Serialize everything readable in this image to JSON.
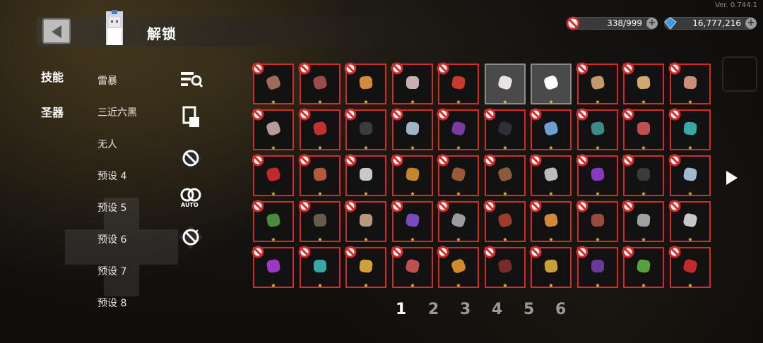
{
  "version": "Ver. 0.744.1",
  "header": {
    "title": "解锁"
  },
  "resources": [
    {
      "name": "coins",
      "value": "338/999"
    },
    {
      "name": "gems",
      "value": "16,777,216"
    }
  ],
  "tabs": [
    "技能",
    "圣器"
  ],
  "presets": [
    "雷暴",
    "三近六黑",
    "无人",
    "预设 4",
    "预设 5",
    "预设 6",
    "预设 7",
    "预设 8"
  ],
  "tools": [
    {
      "name": "equip-search-icon"
    },
    {
      "name": "scroll-hand-icon"
    },
    {
      "name": "ban-icon"
    },
    {
      "name": "auto-icon",
      "label": "AUTO"
    },
    {
      "name": "recycle-ban-icon"
    }
  ],
  "grid": {
    "rows": [
      [
        {
          "icon": "meat-plate-icon",
          "color": "#a06a5a",
          "locked": true
        },
        {
          "icon": "tomato-icon",
          "color": "#9c4a4a",
          "locked": true
        },
        {
          "icon": "amber-gem-icon",
          "color": "#d58a3a",
          "locked": true
        },
        {
          "icon": "feather-icon",
          "color": "#c9b0b0",
          "locked": true
        },
        {
          "icon": "potion-icon",
          "color": "#c63b2a",
          "locked": true
        },
        {
          "icon": "fox-mask-icon",
          "color": "#e9e3e3",
          "locked": false
        },
        {
          "icon": "ghost-icon",
          "color": "#ffffff",
          "locked": false
        },
        {
          "icon": "note-icon",
          "color": "#c49a6c",
          "locked": true
        },
        {
          "icon": "map-icon",
          "color": "#d2a870",
          "locked": true
        },
        {
          "icon": "shell-icon",
          "color": "#c98d7a",
          "locked": true
        }
      ],
      [
        {
          "icon": "needle-icon",
          "color": "#b89a9a",
          "locked": true
        },
        {
          "icon": "demon-mask-icon",
          "color": "#c23030",
          "locked": true
        },
        {
          "icon": "coal-icon",
          "color": "#3c3c3c",
          "locked": true
        },
        {
          "icon": "crystal-shard-icon",
          "color": "#9fb3c9",
          "locked": true
        },
        {
          "icon": "purple-gem-icon",
          "color": "#7a3aa0",
          "locked": true
        },
        {
          "icon": "rock-icon",
          "color": "#2f2f35",
          "locked": true
        },
        {
          "icon": "blue-rock-icon",
          "color": "#6c9fd2",
          "locked": true
        },
        {
          "icon": "tree-icon",
          "color": "#3a8a8a",
          "locked": true
        },
        {
          "icon": "mushroom-icon",
          "color": "#c05050",
          "locked": true
        },
        {
          "icon": "teal-orbs-icon",
          "color": "#3aa7a7",
          "locked": true
        }
      ],
      [
        {
          "icon": "red-scarf-icon",
          "color": "#c02a2a",
          "locked": true
        },
        {
          "icon": "vase-icon",
          "color": "#b45a3a",
          "locked": true
        },
        {
          "icon": "magnifier-icon",
          "color": "#c8c8c8",
          "locked": true
        },
        {
          "icon": "boomerang-icon",
          "color": "#c8842a",
          "locked": true
        },
        {
          "icon": "log-icon",
          "color": "#9a5a3a",
          "locked": true
        },
        {
          "icon": "chocolate-icon",
          "color": "#8a5a3a",
          "locked": true
        },
        {
          "icon": "crystal-ball-icon",
          "color": "#bcbcbc",
          "locked": true
        },
        {
          "icon": "purple-lantern-icon",
          "color": "#8a3ac0",
          "locked": true
        },
        {
          "icon": "book-icon",
          "color": "#3a3a3a",
          "locked": true
        },
        {
          "icon": "ice-cube-icon",
          "color": "#a0b8d0",
          "locked": true
        }
      ],
      [
        {
          "icon": "green-orb-icon",
          "color": "#4a8a3a",
          "locked": true
        },
        {
          "icon": "rifle-icon",
          "color": "#6a5a4a",
          "locked": true
        },
        {
          "icon": "pelt-icon",
          "color": "#b89a7a",
          "locked": true
        },
        {
          "icon": "staff-icon",
          "color": "#7a4ac0",
          "locked": true
        },
        {
          "icon": "crossed-swords-icon",
          "color": "#9a9aa0",
          "locked": true
        },
        {
          "icon": "leaf-icon",
          "color": "#a03a2a",
          "locked": true
        },
        {
          "icon": "plank-icon",
          "color": "#d08a3a",
          "locked": true
        },
        {
          "icon": "meat-icon",
          "color": "#9a4a3a",
          "locked": true
        },
        {
          "icon": "dagger-icon",
          "color": "#a0a0a0",
          "locked": true
        },
        {
          "icon": "blade-icon",
          "color": "#c8c8c8",
          "locked": true
        }
      ],
      [
        {
          "icon": "purple-dot-icon",
          "color": "#9a3ac0",
          "locked": true
        },
        {
          "icon": "robot-icon",
          "color": "#3aa7a7",
          "locked": true
        },
        {
          "icon": "gold-bar-icon",
          "color": "#d0a03a",
          "locked": true
        },
        {
          "icon": "boot-icon",
          "color": "#c05050",
          "locked": true
        },
        {
          "icon": "orange-coin-icon",
          "color": "#d08a2a",
          "locked": true
        },
        {
          "icon": "spider-icon",
          "color": "#7a2a2a",
          "locked": true
        },
        {
          "icon": "gold-coin-icon",
          "color": "#c8a03a",
          "locked": true
        },
        {
          "icon": "purple-cloth-icon",
          "color": "#6a3a9a",
          "locked": true
        },
        {
          "icon": "green-grapes-icon",
          "color": "#5aa03a",
          "locked": true
        },
        {
          "icon": "red-gem-icon",
          "color": "#c02a2a",
          "locked": true
        }
      ]
    ]
  },
  "pages": [
    "1",
    "2",
    "3",
    "4",
    "5",
    "6"
  ],
  "active_page": 0
}
